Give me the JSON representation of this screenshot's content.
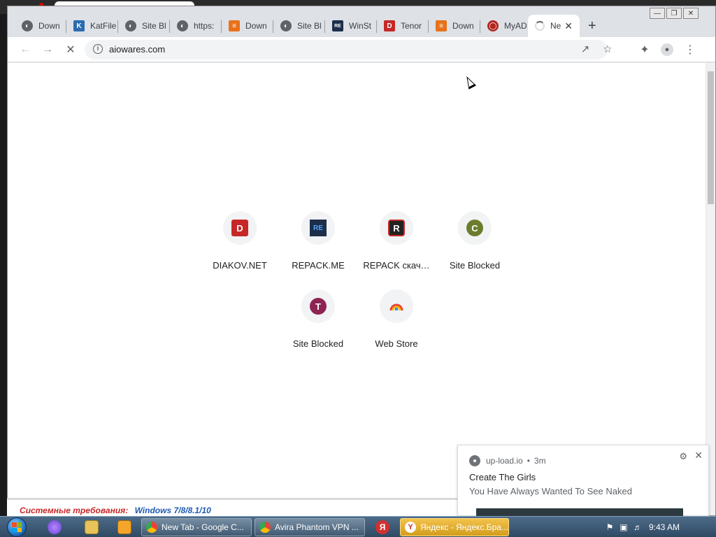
{
  "browser": {
    "tabs": [
      {
        "label": "Down",
        "icon": "globe-icon"
      },
      {
        "label": "KatFile",
        "icon": "katfile-icon"
      },
      {
        "label": "Site Bl",
        "icon": "globe-icon"
      },
      {
        "label": "https:",
        "icon": "globe-icon"
      },
      {
        "label": "Down",
        "icon": "layers-icon"
      },
      {
        "label": "Site Bl",
        "icon": "globe-icon"
      },
      {
        "label": "WinSt",
        "icon": "repack-icon"
      },
      {
        "label": "Tenor",
        "icon": "diakov-icon"
      },
      {
        "label": "Down",
        "icon": "layers-icon"
      },
      {
        "label": "MyAD",
        "icon": "myad-icon"
      },
      {
        "label": "Ne",
        "icon": "loading-spinner-icon",
        "active": true
      }
    ],
    "address": "aiowares.com",
    "colors": {
      "accent": "#1a73e8",
      "tab_bg": "#dee1e6"
    }
  },
  "newtab": {
    "shortcuts": [
      {
        "label": "DIAKOV.NET",
        "icon": "diakov-icon",
        "color": "#c62828",
        "letter": "D"
      },
      {
        "label": "REPACK.ME",
        "icon": "repack-icon",
        "color": "#1c2e4a",
        "letter": "RE"
      },
      {
        "label": "REPACK скач…",
        "icon": "repack-r-icon",
        "color": "#c62828",
        "letter": "R"
      },
      {
        "label": "Site Blocked",
        "icon": "letter-c-icon",
        "color": "#6b7d2c",
        "letter": "C"
      },
      {
        "label": "Site Blocked",
        "icon": "letter-t-icon",
        "color": "#8e2454",
        "letter": "T"
      },
      {
        "label": "Web Store",
        "icon": "webstore-icon",
        "color": "#4285f4",
        "letter": ""
      }
    ]
  },
  "page_footer": {
    "requirements": "Системные требования:",
    "os": "Windows 7/8/8.1/10"
  },
  "notification": {
    "source": "up-load.io",
    "time": "3m",
    "title": "Create The Girls",
    "body": "You Have Always Wanted To See Naked"
  },
  "taskbar": {
    "tasks": [
      {
        "label": "New Tab - Google C...",
        "icon": "chrome-icon"
      },
      {
        "label": "Avira Phantom VPN ...",
        "icon": "chrome-icon"
      },
      {
        "label": "Яндекс - Яндекс.Бра...",
        "icon": "yandex-icon"
      }
    ],
    "clock": "9:43 AM"
  }
}
